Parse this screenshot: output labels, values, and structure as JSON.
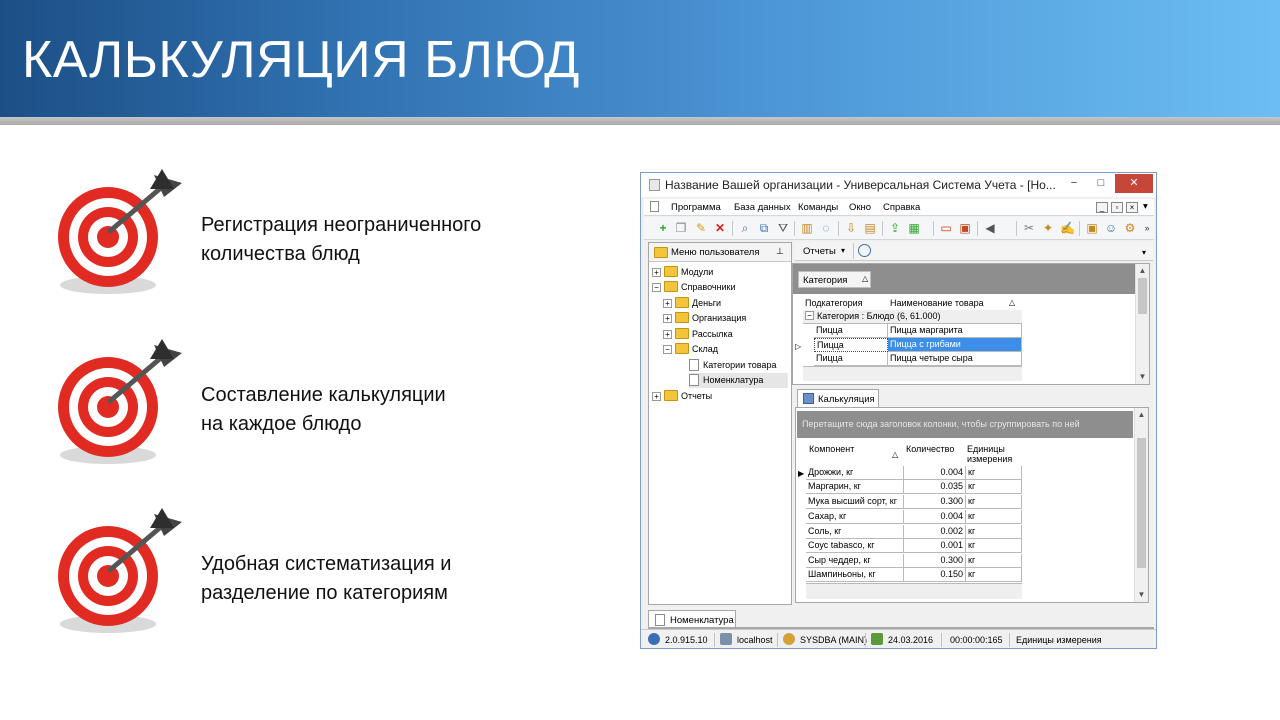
{
  "slide": {
    "title": "КАЛЬКУЛЯЦИЯ БЛЮД",
    "bullets": [
      {
        "line1": "Регистрация неограниченного",
        "line2": "количества блюд"
      },
      {
        "line1": "Составление калькуляции",
        "line2": "на каждое блюдо"
      },
      {
        "line1": "Удобная систематизация и",
        "line2": "разделение по категориям"
      }
    ]
  },
  "window": {
    "title": "Название Вашей организации - Универсальная Система Учета - [Но...",
    "buttons": {
      "minimize": "−",
      "maximize": "□",
      "close": "✕"
    },
    "menu": [
      "Программа",
      "База данных",
      "Команды",
      "Окно",
      "Справка"
    ],
    "left_panel": {
      "header": "Меню пользователя",
      "tree": [
        {
          "label": "Модули",
          "expander": "+"
        },
        {
          "label": "Справочники",
          "expander": "−"
        },
        {
          "label": "Деньги",
          "expander": "+"
        },
        {
          "label": "Организация",
          "expander": "+"
        },
        {
          "label": "Рассылка",
          "expander": "+"
        },
        {
          "label": "Склад",
          "expander": "−"
        },
        {
          "label": "Категории товара"
        },
        {
          "label": "Номенклатура"
        },
        {
          "label": "Отчеты",
          "expander": "+"
        }
      ]
    },
    "reports_menu": "Отчеты",
    "top_grid": {
      "group_button": "Категория",
      "sort_glyph": "△",
      "columns": [
        "Подкатегория",
        "Наименование товара"
      ],
      "group_row": "Категория : Блюдо (6, 61.000)",
      "rows": [
        [
          "Пицца",
          "Пицца маргарита"
        ],
        [
          "Пицца",
          "Пицца с грибами"
        ],
        [
          "Пицца",
          "Пицца четыре сыра"
        ]
      ]
    },
    "calc_tab": "Калькуляция",
    "calc_grid": {
      "drop_hint": "Перетащите сюда заголовок колонки, чтобы сгруппировать по ней",
      "columns": {
        "component": "Компонент",
        "quantity": "Количество",
        "units_1": "Единицы",
        "units_2": "измерения"
      },
      "rows": [
        [
          "Дрожжи, кг",
          "0.004",
          "кг"
        ],
        [
          "Маргарин, кг",
          "0.035",
          "кг"
        ],
        [
          "Мука высший сорт, кг",
          "0.300",
          "кг"
        ],
        [
          "Сахар, кг",
          "0.004",
          "кг"
        ],
        [
          "Соль, кг",
          "0.002",
          "кг"
        ],
        [
          "Соус tabasco, кг",
          "0.001",
          "кг"
        ],
        [
          "Сыр чеддер, кг",
          "0.300",
          "кг"
        ],
        [
          "Шампиньоны, кг",
          "0.150",
          "кг"
        ]
      ]
    },
    "bottom_tab": "Номенклатура",
    "status": {
      "version": "2.0.915.10",
      "server": "localhost",
      "user": "SYSDBA (MAIN)",
      "date": "24.03.2016",
      "timer": "00:00:00:165",
      "hint": "Единицы измерения"
    },
    "colors": {
      "accent": "#3c8ee8",
      "close": "#c7463a",
      "folder": "#f2c53d"
    }
  }
}
